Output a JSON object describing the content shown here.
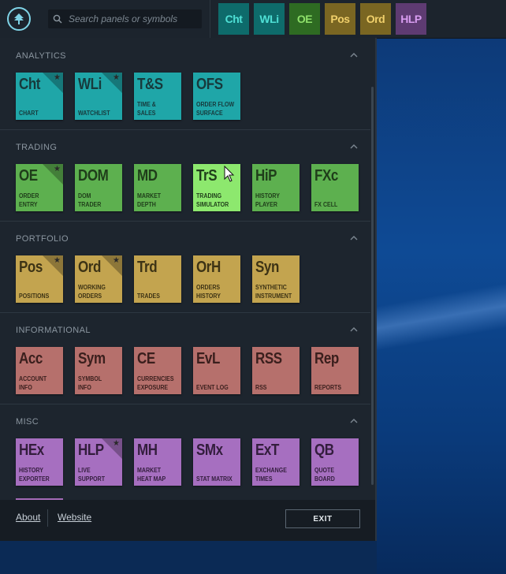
{
  "search": {
    "placeholder": "Search panels or symbols"
  },
  "quick_tiles": [
    {
      "label": "Cht",
      "bg": "#0e6b6b",
      "fg": "#4fe0d6"
    },
    {
      "label": "WLi",
      "bg": "#0e6b6b",
      "fg": "#4fe0d6"
    },
    {
      "label": "OE",
      "bg": "#2e6b22",
      "fg": "#8ee06a"
    },
    {
      "label": "Pos",
      "bg": "#7a6622",
      "fg": "#f0cf6a"
    },
    {
      "label": "Ord",
      "bg": "#7a6622",
      "fg": "#f0cf6a"
    },
    {
      "label": "HLP",
      "bg": "#5e3b72",
      "fg": "#d89cf0"
    }
  ],
  "sections": [
    {
      "title": "ANALYTICS",
      "color": "#1fa6a8",
      "text": "#173a3c",
      "tiles": [
        {
          "abbr": "Cht",
          "label": "CHART",
          "star": true
        },
        {
          "abbr": "WLi",
          "label": "WATCHLIST",
          "star": true
        },
        {
          "abbr": "T&S",
          "label": "TIME &\nSALES",
          "star": false
        },
        {
          "abbr": "OFS",
          "label": "ORDER FLOW\nSURFACE",
          "star": false
        }
      ]
    },
    {
      "title": "TRADING",
      "color": "#5db04f",
      "text": "#1f3d1a",
      "tiles": [
        {
          "abbr": "OE",
          "label": "ORDER\nENTRY",
          "star": true
        },
        {
          "abbr": "DOM",
          "label": "DOM\nTRADER",
          "star": false
        },
        {
          "abbr": "MD",
          "label": "MARKET\nDEPTH",
          "star": false
        },
        {
          "abbr": "TrS",
          "label": "TRADING\nSIMULATOR",
          "star": false,
          "highlight": "#8de86e"
        },
        {
          "abbr": "HiP",
          "label": "HISTORY\nPLAYER",
          "star": false
        },
        {
          "abbr": "FXc",
          "label": "FX CELL",
          "star": false
        }
      ]
    },
    {
      "title": "PORTFOLIO",
      "color": "#c3a44f",
      "text": "#3d3315",
      "tiles": [
        {
          "abbr": "Pos",
          "label": "POSITIONS",
          "star": true
        },
        {
          "abbr": "Ord",
          "label": "WORKING\nORDERS",
          "star": true
        },
        {
          "abbr": "Trd",
          "label": "TRADES",
          "star": false
        },
        {
          "abbr": "OrH",
          "label": "ORDERS\nHISTORY",
          "star": false
        },
        {
          "abbr": "Syn",
          "label": "SYNTHETIC\nINSTRUMENT",
          "star": false
        }
      ]
    },
    {
      "title": "INFORMATIONAL",
      "color": "#b6706c",
      "text": "#3a1f1d",
      "tiles": [
        {
          "abbr": "Acc",
          "label": "ACCOUNT\nINFO",
          "star": false
        },
        {
          "abbr": "Sym",
          "label": "SYMBOL\nINFO",
          "star": false
        },
        {
          "abbr": "CE",
          "label": "CURRENCIES\nEXPOSURE",
          "star": false
        },
        {
          "abbr": "EvL",
          "label": "EVENT LOG",
          "star": false
        },
        {
          "abbr": "RSS",
          "label": "RSS",
          "star": false
        },
        {
          "abbr": "Rep",
          "label": "REPORTS",
          "star": false
        }
      ]
    },
    {
      "title": "MISC",
      "color": "#a66fc0",
      "text": "#331d3d",
      "tiles": [
        {
          "abbr": "HEx",
          "label": "HISTORY\nEXPORTER",
          "star": false
        },
        {
          "abbr": "HLP",
          "label": "LIVE\nSUPPORT",
          "star": true
        },
        {
          "abbr": "MH",
          "label": "MARKET\nHEAT MAP",
          "star": false
        },
        {
          "abbr": "SMx",
          "label": "STAT MATRIX",
          "star": false
        },
        {
          "abbr": "ExT",
          "label": "EXCHANGE\nTIMES",
          "star": false
        },
        {
          "abbr": "QB",
          "label": "QUOTE\nBOARD",
          "star": false
        }
      ]
    }
  ],
  "footer": {
    "about": "About",
    "website": "Website",
    "exit": "EXIT"
  }
}
